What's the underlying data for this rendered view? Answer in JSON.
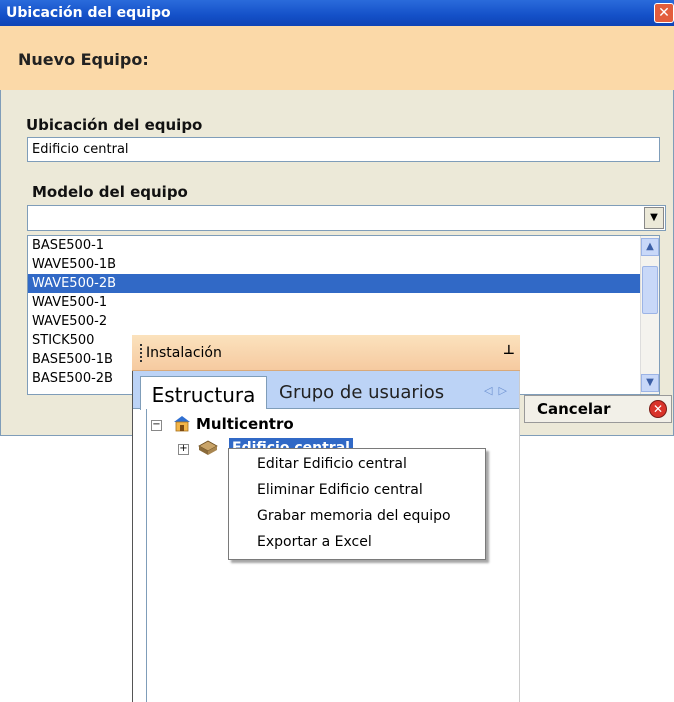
{
  "dialog": {
    "title": "Ubicación del equipo",
    "close_glyph": "✕",
    "header": "Nuevo Equipo:",
    "location_label": "Ubicación del equipo",
    "location_value": "Edificio central",
    "model_label": "Modelo del equipo",
    "model_value": "",
    "model_options": [
      "BASE500-1",
      "WAVE500-1B",
      "WAVE500-2B",
      "WAVE500-1",
      "WAVE500-2",
      "STICK500",
      "BASE500-1B",
      "BASE500-2B"
    ],
    "selected_option": "WAVE500-2B",
    "cancel_label": "Cancelar"
  },
  "panel": {
    "title": "Instalación",
    "pin_glyph": "⊥",
    "tabs": [
      {
        "label": "Estructura",
        "active": true
      },
      {
        "label": "Grupo de usuarios",
        "active": false
      }
    ],
    "tree": {
      "root": "Multicentro",
      "child": "Edificio central"
    }
  },
  "context_menu": {
    "items": [
      "Editar Edificio central",
      "Eliminar Edificio central",
      "Grabar memoria del equipo",
      "Exportar a Excel"
    ]
  },
  "colors": {
    "titlebar": "#1450c8",
    "header_band": "#fbd9a8",
    "selection": "#3169c6",
    "panel_title": "#f6caa0",
    "tabs_bar": "#bcd3f6"
  }
}
